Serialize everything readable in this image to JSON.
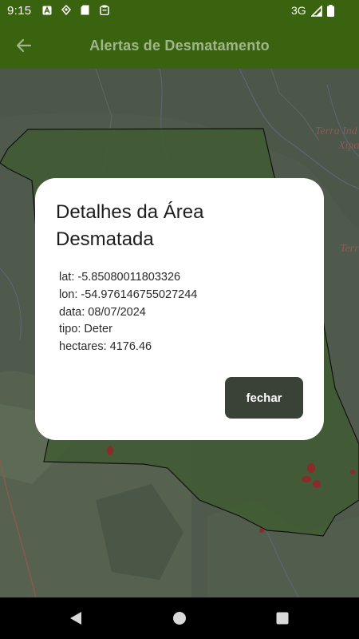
{
  "status_bar": {
    "time": "9:15",
    "network": "3G",
    "icons": [
      "a-notification-icon",
      "location-icon",
      "sd-card-icon",
      "clipboard-icon",
      "signal-icon",
      "battery-icon"
    ]
  },
  "app_bar": {
    "title": "Alertas de Desmatamento",
    "back_icon": "arrow-back-icon"
  },
  "map": {
    "labels": [
      "Terra Ind",
      "Xipa",
      "Terr"
    ],
    "colors": {
      "polygon_fill": "#3f5c33",
      "polygon_stroke": "#111111",
      "deforestation_patch": "#8a2a2a"
    }
  },
  "dialog": {
    "title": "Detalhes da Área Desmatada",
    "lines": [
      "lat: -5.85080011803326",
      "lon: -54.976146755027244",
      "data: 08/07/2024",
      "tipo: Deter",
      "hectares: 4176.46"
    ],
    "close_label": "fechar"
  },
  "nav_bar": {
    "icons": [
      "back-triangle-icon",
      "home-circle-icon",
      "recents-square-icon"
    ]
  },
  "colors": {
    "app_bar": "#3a6310",
    "app_bar_title": "#a0b68a",
    "button": "#3a4238",
    "dialog_bg": "#ffffff"
  }
}
